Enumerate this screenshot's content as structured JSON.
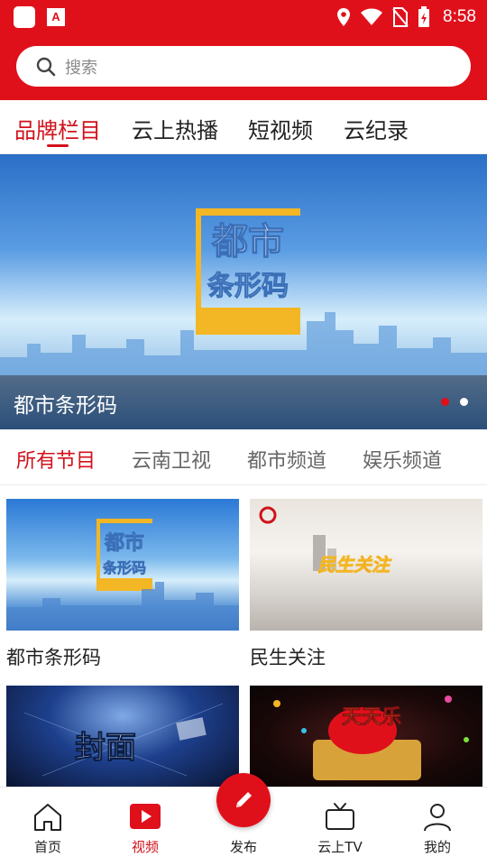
{
  "status_bar": {
    "time": "8:58",
    "app_badge": "A"
  },
  "search": {
    "placeholder": "搜索"
  },
  "top_tabs": [
    {
      "label": "品牌栏目",
      "active": true
    },
    {
      "label": "云上热播",
      "active": false
    },
    {
      "label": "短视频",
      "active": false
    },
    {
      "label": "云纪录",
      "active": false
    }
  ],
  "banner": {
    "logo_line1": "都市",
    "logo_line2": "条形码",
    "caption": "都市条形码",
    "slides_total": 2,
    "active_slide": 1
  },
  "channel_tabs": [
    {
      "label": "所有节目",
      "active": true
    },
    {
      "label": "云南卫视",
      "active": false
    },
    {
      "label": "都市频道",
      "active": false
    },
    {
      "label": "娱乐频道",
      "active": false
    }
  ],
  "programs": [
    {
      "title": "都市条形码",
      "thumb_logo_line1": "都市",
      "thumb_logo_line2": "条形码"
    },
    {
      "title": "民生关注",
      "thumb_logo": "民生关注"
    },
    {
      "title": "",
      "thumb_logo": "封面"
    },
    {
      "title": "",
      "thumb_logo": "天天乐"
    }
  ],
  "bottom_nav": [
    {
      "label": "首页",
      "icon": "home-icon",
      "active": false
    },
    {
      "label": "视频",
      "icon": "video-play-icon",
      "active": true
    },
    {
      "label": "发布",
      "icon": "pencil-icon",
      "active": false
    },
    {
      "label": "云上TV",
      "icon": "tv-icon",
      "active": false
    },
    {
      "label": "我的",
      "icon": "user-icon",
      "active": false
    }
  ],
  "colors": {
    "brand_red": "#e0101b",
    "active_text": "#d1121b"
  }
}
